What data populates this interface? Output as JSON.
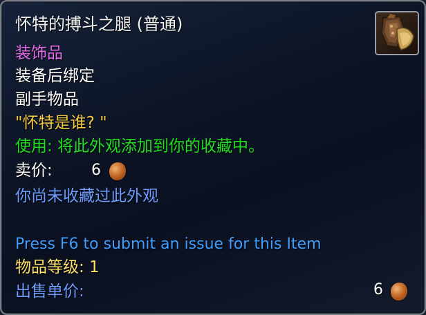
{
  "item": {
    "name": "怀特的搏斗之腿 (普通)",
    "type": "装饰品",
    "binding": "装备后绑定",
    "slot": "副手物品",
    "flavor": "\"怀特是谁? \"",
    "use": "使用: 将此外观添加到你的收藏中。",
    "sell_label": "卖价:",
    "sell_price": "6",
    "collection_status": "你尚未收藏过此外观",
    "report": "Press F6 to submit an issue for this Item",
    "item_level": "物品等级: 1",
    "unit_price_label": "出售单价:",
    "unit_price": "6",
    "icon": "leather-leg-armor-icon",
    "coin_icon": "copper-coin-icon"
  },
  "colors": {
    "title": "#f3f3f3",
    "type": "#e26bea",
    "flavor": "#f2c744",
    "use": "#22dd22",
    "collection": "#6e9dff",
    "report": "#3f9eff",
    "item_level": "#ffe06a"
  }
}
